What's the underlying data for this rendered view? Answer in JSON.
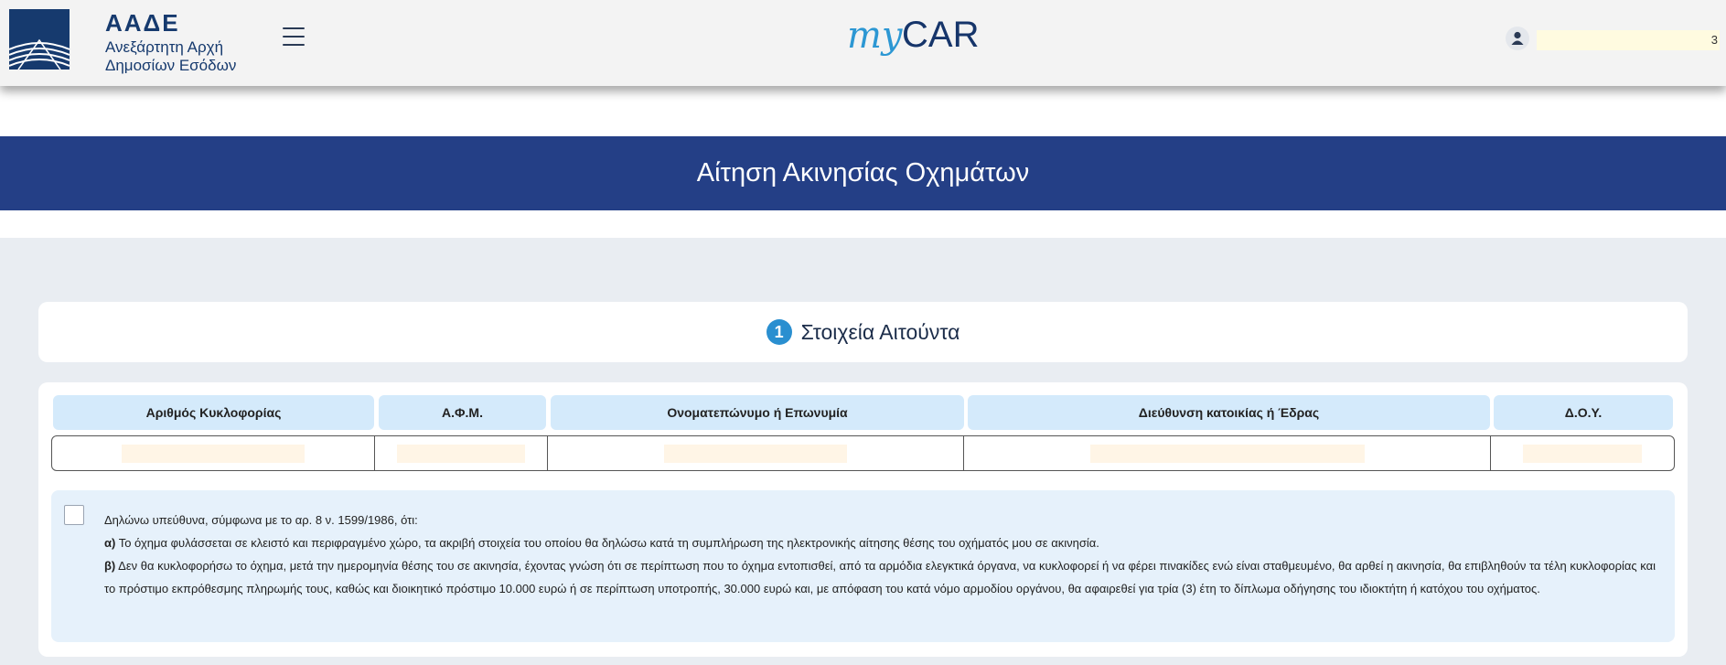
{
  "header": {
    "logo_title": "ΑΑΔΕ",
    "logo_sub1": "Ανεξάρτητη Αρχή",
    "logo_sub2": "Δημοσίων Εσόδων",
    "brand_my": "my",
    "brand_car": "CAR",
    "user_name": "3",
    "icons": {
      "menu": "menu-icon",
      "user": "user-icon",
      "logo": "aade-logo-icon"
    }
  },
  "page_title": "Αίτηση Ακινησίας Οχημάτων",
  "step": {
    "number": "1",
    "label": "Στοιχεία Αιτούντα"
  },
  "table": {
    "headers": [
      "Αριθμός Κυκλοφορίας",
      "Α.Φ.Μ.",
      "Ονοματεπώνυμο ή Επωνυμία",
      "Διεύθυνση κατοικίας ή Έδρας",
      "Δ.Ο.Υ."
    ],
    "row": [
      "",
      "",
      "",
      "",
      ""
    ]
  },
  "declaration": {
    "intro": "Δηλώνω υπεύθυνα, σύμφωνα με το αρ. 8 ν. 1599/1986, ότι:",
    "a_label": "α)",
    "a_text": " Το όχημα φυλάσσεται σε κλειστό και περιφραγμένο χώρο, τα ακριβή στοιχεία του οποίου θα δηλώσω κατά τη συμπλήρωση της ηλεκτρονικής αίτησης θέσης του οχήματός μου σε ακινησία.",
    "b_label": "β)",
    "b_text": " Δεν θα κυκλοφορήσω το όχημα, μετά την ημερομηνία θέσης του σε ακινησία, έχοντας γνώση ότι σε περίπτωση που το όχημα εντοπισθεί, από τα αρμόδια ελεγκτικά όργανα, να κυκλοφορεί ή να φέρει πινακίδες ενώ είναι σταθμευμένο, θα αρθεί η ακινησία, θα επιβληθούν τα τέλη κυκλοφορίας και το πρόστιμο εκπρόθεσμης πληρωμής τους, καθώς και διοικητικό πρόστιμο 10.000 ευρώ ή σε περίπτωση υποτροπής, 30.000 ευρώ και, με απόφαση του κατά νόμο αρμοδίου οργάνου, θα αφαιρεθεί για τρία (3) έτη το δίπλωμα οδήγησης του ιδιοκτήτη ή κατόχου του οχήματος."
  },
  "colors": {
    "banner": "#243f86",
    "brand_blue": "#2c97d3",
    "brand_navy": "#16356a",
    "header_cell": "#d4eafb",
    "declaration_bg": "#e6f1fb"
  }
}
